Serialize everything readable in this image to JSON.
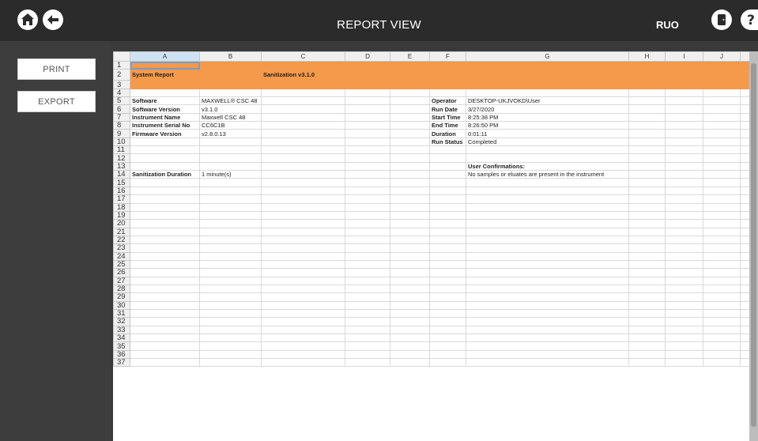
{
  "header": {
    "title": "REPORT VIEW",
    "badge": "RUO",
    "icons": [
      "home-icon",
      "back-arrow-icon",
      "door-exit-icon",
      "help-icon"
    ]
  },
  "sidebar": {
    "print_label": "PRINT",
    "export_label": "EXPORT"
  },
  "sheet": {
    "columns": [
      "A",
      "B",
      "C",
      "D",
      "E",
      "F",
      "G",
      "H",
      "I",
      "J"
    ],
    "report_title": "System Report",
    "report_subtitle": "Sanitization v3.1.0",
    "left_fields": [
      {
        "label": "Software",
        "value": "MAXWELL® CSC 48"
      },
      {
        "label": "Software Version",
        "value": "v3.1.0"
      },
      {
        "label": "Instrument Name",
        "value": "Maxwell CSC 48"
      },
      {
        "label": "Instrument Serial No",
        "value": "CC6C1B"
      },
      {
        "label": "Firmware Version",
        "value": "v2.8.0.13"
      }
    ],
    "right_fields": [
      {
        "label": "Operator",
        "value": "DESKTOP-UKJVOKD\\User"
      },
      {
        "label": "Run Date",
        "value": "3/27/2020"
      },
      {
        "label": "Start Time",
        "value": "8:25:38 PM"
      },
      {
        "label": "End Time",
        "value": "8:26:50 PM"
      },
      {
        "label": "Duration",
        "value": "0:01:11"
      },
      {
        "label": "Run Status",
        "value": "Completed"
      }
    ],
    "duration_label": "Sanitization Duration",
    "duration_value": "1 minute(s)",
    "confirm_heading": "User Confirmations:",
    "confirm_text": "No samples or eluates are present in the instrument",
    "row_count": 37
  },
  "colors": {
    "header_bg": "#2b2b2b",
    "sidebar_bg": "#3d3d3d",
    "accent_orange": "#f5994a"
  }
}
